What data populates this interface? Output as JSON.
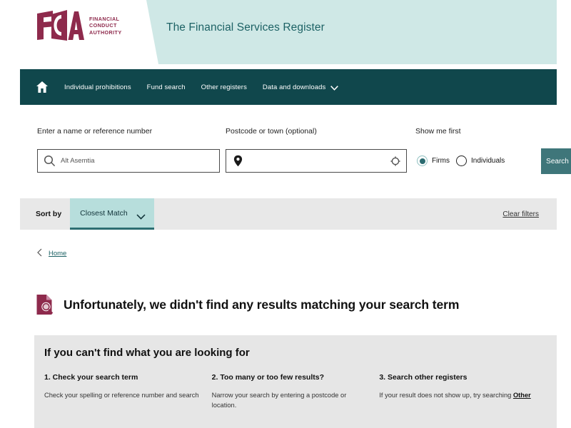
{
  "brand": {
    "logo_letters": "FCA",
    "logo_words_line1": "FINANCIAL",
    "logo_words_line2": "CONDUCT",
    "logo_words_line3": "AUTHORITY",
    "header_title": "The Financial Services Register",
    "logo_color": "#8e2a4c",
    "header_band_color": "#cfe8e6",
    "nav_color": "#10474c",
    "accent_color": "#3f767a"
  },
  "nav": {
    "home_icon": "home-icon",
    "items": [
      {
        "label": "Individual prohibitions",
        "has_chevron": false
      },
      {
        "label": "Fund search",
        "has_chevron": false
      },
      {
        "label": "Other registers",
        "has_chevron": false
      },
      {
        "label": "Data and downloads",
        "has_chevron": true
      }
    ]
  },
  "search": {
    "name_label": "Enter a name or reference number",
    "name_value": "Alt Asemtia",
    "name_icon": "search-icon",
    "postcode_label": "Postcode or town (optional)",
    "postcode_value": "",
    "postcode_placeholder": "",
    "postcode_icon": "map-pin-icon",
    "postcode_trailing_icon": "location-target-icon",
    "show_me_first_label": "Show me first",
    "options": [
      {
        "label": "Firms",
        "selected": true
      },
      {
        "label": "Individuals",
        "selected": false
      }
    ],
    "search_button": "Search"
  },
  "sort": {
    "label": "Sort by",
    "value": "Closest Match",
    "chevron_icon": "chevron-down-icon",
    "clear_filters": "Clear filters"
  },
  "breadcrumb": {
    "back_icon": "chevron-left-icon",
    "home": "Home"
  },
  "result": {
    "icon": "document-search-icon",
    "title": "Unfortunately, we didn't find any results matching your search term"
  },
  "help": {
    "title": "If you can't find what you are looking for",
    "columns": [
      {
        "heading": "1. Check your search term",
        "body": "Check your spelling or reference number and search",
        "link": ""
      },
      {
        "heading": "2. Too many or too few results?",
        "body": "Narrow your search by entering a postcode or location.",
        "link": ""
      },
      {
        "heading": "3. Search other registers",
        "body": "If your result does not show up, try searching ",
        "link": "Other"
      }
    ]
  }
}
